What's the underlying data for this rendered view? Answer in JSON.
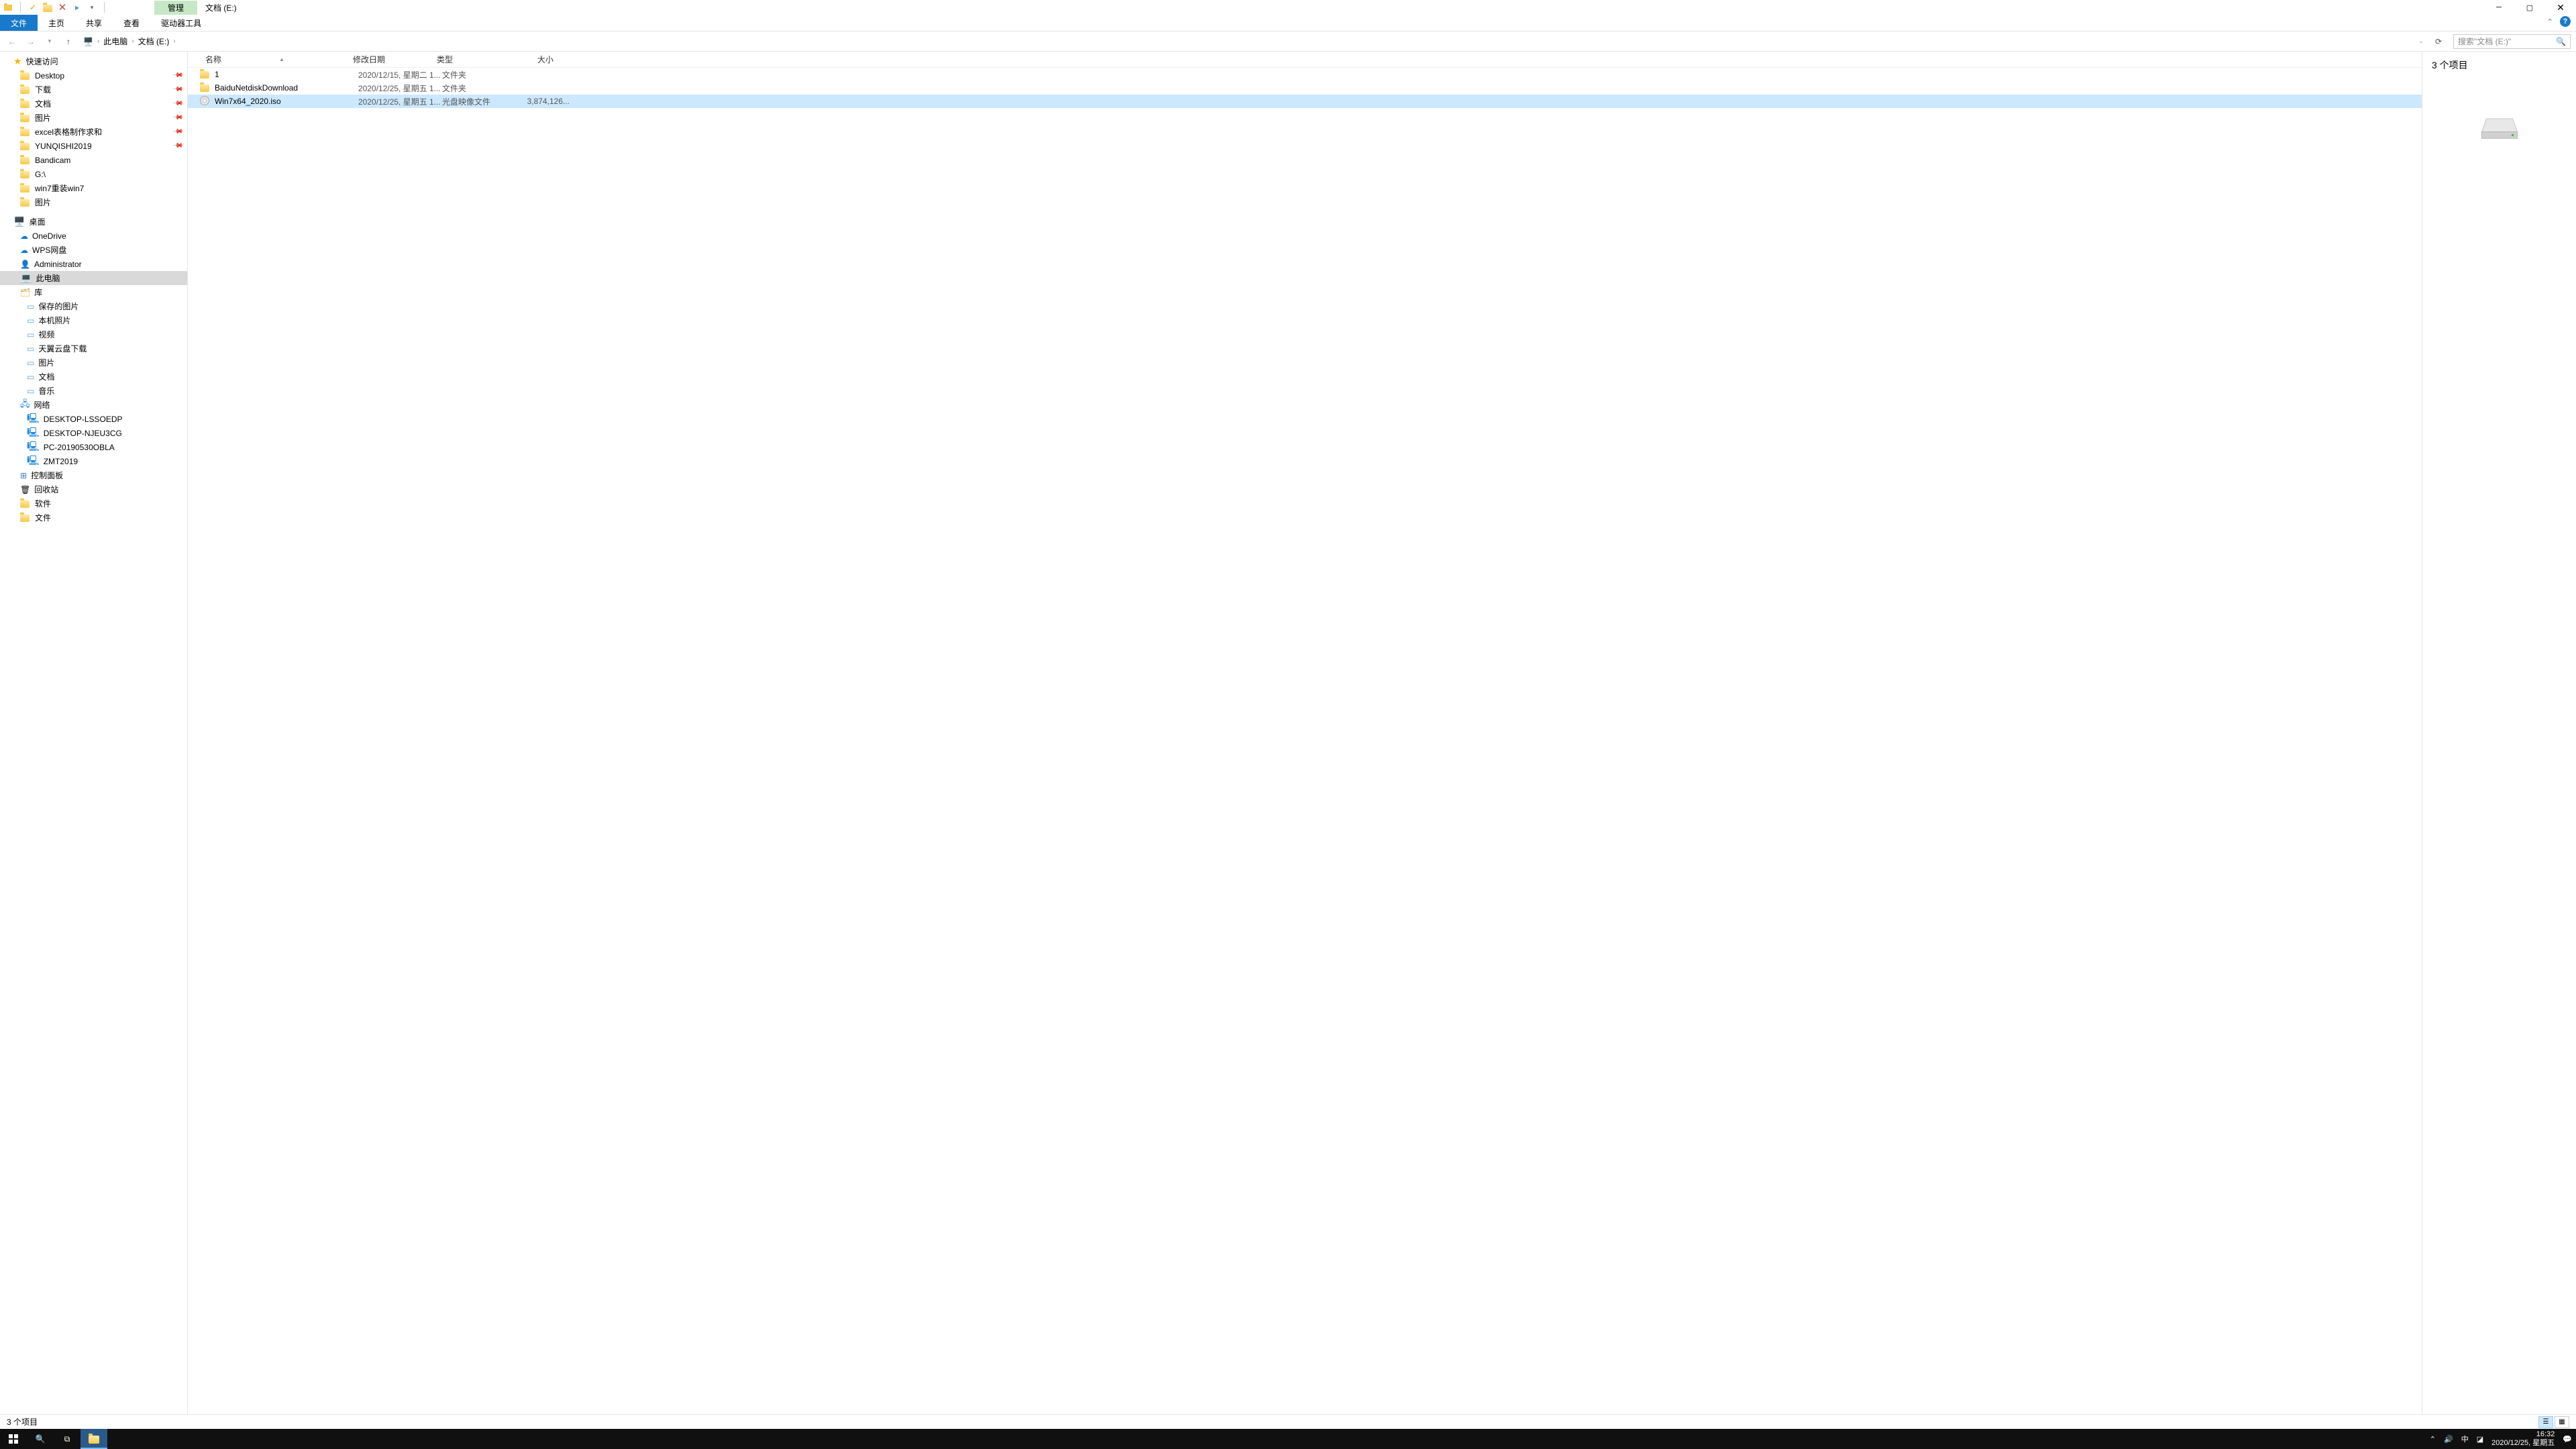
{
  "title": {
    "manage_tab": "管理",
    "window_title": "文档 (E:)"
  },
  "ribbon": {
    "file": "文件",
    "home": "主页",
    "share": "共享",
    "view": "查看",
    "drive_tools": "驱动器工具"
  },
  "address": {
    "root": "此电脑",
    "loc": "文档 (E:)",
    "search_placeholder": "搜索\"文档 (E:)\""
  },
  "nav": {
    "quick_access": "快速访问",
    "qa_items": [
      {
        "label": "Desktop",
        "pin": true
      },
      {
        "label": "下载",
        "pin": true
      },
      {
        "label": "文档",
        "pin": true
      },
      {
        "label": "图片",
        "pin": true
      },
      {
        "label": "excel表格制作求和",
        "pin": true
      },
      {
        "label": "YUNQISHI2019",
        "pin": true
      },
      {
        "label": "Bandicam",
        "pin": false
      },
      {
        "label": "G:\\",
        "pin": false
      },
      {
        "label": "win7重装win7",
        "pin": false
      },
      {
        "label": "图片",
        "pin": false
      }
    ],
    "desktop": "桌面",
    "desk_items": [
      "OneDrive",
      "WPS网盘",
      "Administrator",
      "此电脑",
      "库"
    ],
    "lib_items": [
      "保存的图片",
      "本机照片",
      "视频",
      "天翼云盘下载",
      "图片",
      "文档",
      "音乐"
    ],
    "network": "网络",
    "net_items": [
      "DESKTOP-LSSOEDP",
      "DESKTOP-NJEU3CG",
      "PC-20190530OBLA",
      "ZMT2019"
    ],
    "control_panel": "控制面板",
    "recycle": "回收站",
    "soft": "软件",
    "docs": "文件"
  },
  "columns": {
    "name": "名称",
    "date": "修改日期",
    "type": "类型",
    "size": "大小"
  },
  "files": [
    {
      "name": "1",
      "date": "2020/12/15, 星期二 1...",
      "type": "文件夹",
      "size": "",
      "icon": "folder",
      "sel": false
    },
    {
      "name": "BaiduNetdiskDownload",
      "date": "2020/12/25, 星期五 1...",
      "type": "文件夹",
      "size": "",
      "icon": "folder",
      "sel": false
    },
    {
      "name": "Win7x64_2020.iso",
      "date": "2020/12/25, 星期五 1...",
      "type": "光盘映像文件",
      "size": "3,874,126...",
      "icon": "disc",
      "sel": true
    }
  ],
  "preview": {
    "count_text": "3 个项目"
  },
  "status": {
    "text": "3 个项目"
  },
  "taskbar": {
    "time": "16:32",
    "date": "2020/12/25, 星期五",
    "ime": "中"
  }
}
